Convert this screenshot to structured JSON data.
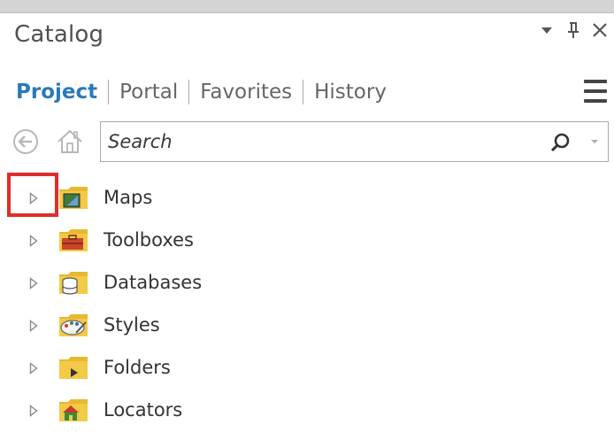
{
  "pane": {
    "title": "Catalog"
  },
  "window_controls": {
    "dropdown_icon": "caret-down-icon",
    "pin_icon": "pin-icon",
    "close_icon": "close-icon"
  },
  "tabs": [
    {
      "label": "Project",
      "active": true
    },
    {
      "label": "Portal",
      "active": false
    },
    {
      "label": "Favorites",
      "active": false
    },
    {
      "label": "History",
      "active": false
    }
  ],
  "toolbar": {
    "back_icon": "back-arrow-icon",
    "home_icon": "home-icon",
    "menu_icon": "hamburger-menu-icon"
  },
  "search": {
    "placeholder": "Search",
    "value": ""
  },
  "tree": {
    "items": [
      {
        "label": "Maps",
        "icon": "maps-folder-icon"
      },
      {
        "label": "Toolboxes",
        "icon": "toolboxes-folder-icon"
      },
      {
        "label": "Databases",
        "icon": "databases-folder-icon"
      },
      {
        "label": "Styles",
        "icon": "styles-folder-icon"
      },
      {
        "label": "Folders",
        "icon": "folders-folder-icon"
      },
      {
        "label": "Locators",
        "icon": "locators-folder-icon"
      }
    ]
  },
  "colors": {
    "active_tab": "#2a7ab8",
    "highlight": "#e12c2c",
    "folder": "#e8b830"
  }
}
